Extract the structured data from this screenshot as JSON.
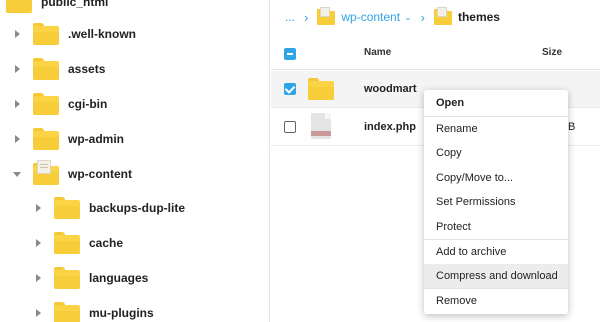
{
  "tree": {
    "root_label": "public_html",
    "items": [
      {
        "label": ".well-known"
      },
      {
        "label": "assets"
      },
      {
        "label": "cgi-bin"
      },
      {
        "label": "wp-admin"
      },
      {
        "label": "wp-content"
      },
      {
        "label": "backups-dup-lite"
      },
      {
        "label": "cache"
      },
      {
        "label": "languages"
      },
      {
        "label": "mu-plugins"
      }
    ]
  },
  "breadcrumb": {
    "ellipsis": "...",
    "separator": "›",
    "parent": "wp-content",
    "parent_caret": "⌄",
    "current": "themes"
  },
  "list": {
    "columns": {
      "name": "Name",
      "size": "Size"
    },
    "rows": [
      {
        "name": "woodmart",
        "size": "",
        "type": "folder",
        "checked": true
      },
      {
        "name": "index.php",
        "size": "B",
        "type": "file",
        "checked": false
      }
    ]
  },
  "context_menu": {
    "items": [
      {
        "label": "Open"
      },
      {
        "label": "Rename"
      },
      {
        "label": "Copy"
      },
      {
        "label": "Copy/Move to..."
      },
      {
        "label": "Set Permissions"
      },
      {
        "label": "Protect"
      },
      {
        "label": "Add to archive"
      },
      {
        "label": "Compress and download"
      },
      {
        "label": "Remove"
      }
    ],
    "highlighted": "Compress and download"
  },
  "colors": {
    "accent": "#2fa4e7",
    "folder": "#f8cd3a",
    "highlight": "#ececec"
  }
}
